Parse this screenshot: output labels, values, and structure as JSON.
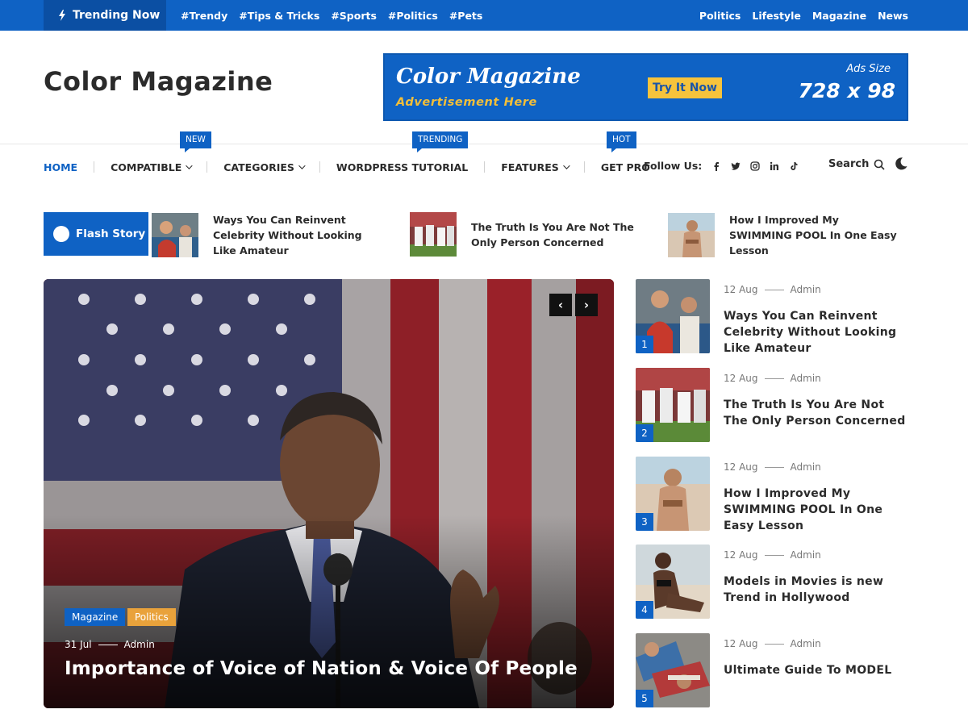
{
  "topbar": {
    "trending_label": "Trending Now",
    "tags": [
      "#Trendy",
      "#Tips & Tricks",
      "#Sports",
      "#Politics",
      "#Pets"
    ],
    "links": [
      "Politics",
      "Lifestyle",
      "Magazine",
      "News"
    ]
  },
  "header": {
    "logo": "Color Magazine",
    "ad": {
      "title": "Color Magazine",
      "subtitle": "Advertisement Here",
      "button": "Try It Now",
      "size_label": "Ads Size",
      "size_value": "728 x 98"
    }
  },
  "nav": {
    "items": [
      {
        "label": "HOME",
        "dropdown": false
      },
      {
        "label": "COMPATIBLE",
        "dropdown": true
      },
      {
        "label": "CATEGORIES",
        "dropdown": true
      },
      {
        "label": "WORDPRESS TUTORIAL",
        "dropdown": false
      },
      {
        "label": "FEATURES",
        "dropdown": true
      },
      {
        "label": "GET PRO",
        "dropdown": false
      }
    ],
    "badges": [
      "NEW",
      "TRENDING",
      "HOT"
    ],
    "follow_label": "Follow Us:",
    "social_icons": [
      "facebook-icon",
      "twitter-icon",
      "instagram-icon",
      "linkedin-icon",
      "tiktok-icon"
    ],
    "search_label": "Search"
  },
  "flash": {
    "label": "Flash Story",
    "items": [
      {
        "title": "Ways You Can Reinvent Celebrity Without Looking Like Amateur"
      },
      {
        "title": "The Truth Is You Are Not The Only Person Concerned"
      },
      {
        "title": "How I Improved My SWIMMING POOL In One Easy Lesson"
      }
    ]
  },
  "hero": {
    "categories": [
      "Magazine",
      "Politics"
    ],
    "date": "31 Jul",
    "author": "Admin",
    "title": "Importance of Voice of Nation & Voice Of People",
    "prev_icon": "chevron-left-icon",
    "next_icon": "chevron-right-icon"
  },
  "side": {
    "items": [
      {
        "num": "1",
        "date": "12 Aug",
        "author": "Admin",
        "title": "Ways You Can Reinvent Celebrity Without Looking Like Amateur"
      },
      {
        "num": "2",
        "date": "12 Aug",
        "author": "Admin",
        "title": "The Truth Is You Are Not The Only Person Concerned"
      },
      {
        "num": "3",
        "date": "12 Aug",
        "author": "Admin",
        "title": "How I Improved My SWIMMING POOL In One Easy Lesson"
      },
      {
        "num": "4",
        "date": "12 Aug",
        "author": "Admin",
        "title": "Models in Movies is new Trend in Hollywood"
      },
      {
        "num": "5",
        "date": "12 Aug",
        "author": "Admin",
        "title": "Ultimate Guide To MODEL"
      }
    ]
  },
  "colors": {
    "primary": "#0f62c4",
    "accent_yellow": "#f6c33c",
    "politics_tag": "#e9a23b"
  }
}
